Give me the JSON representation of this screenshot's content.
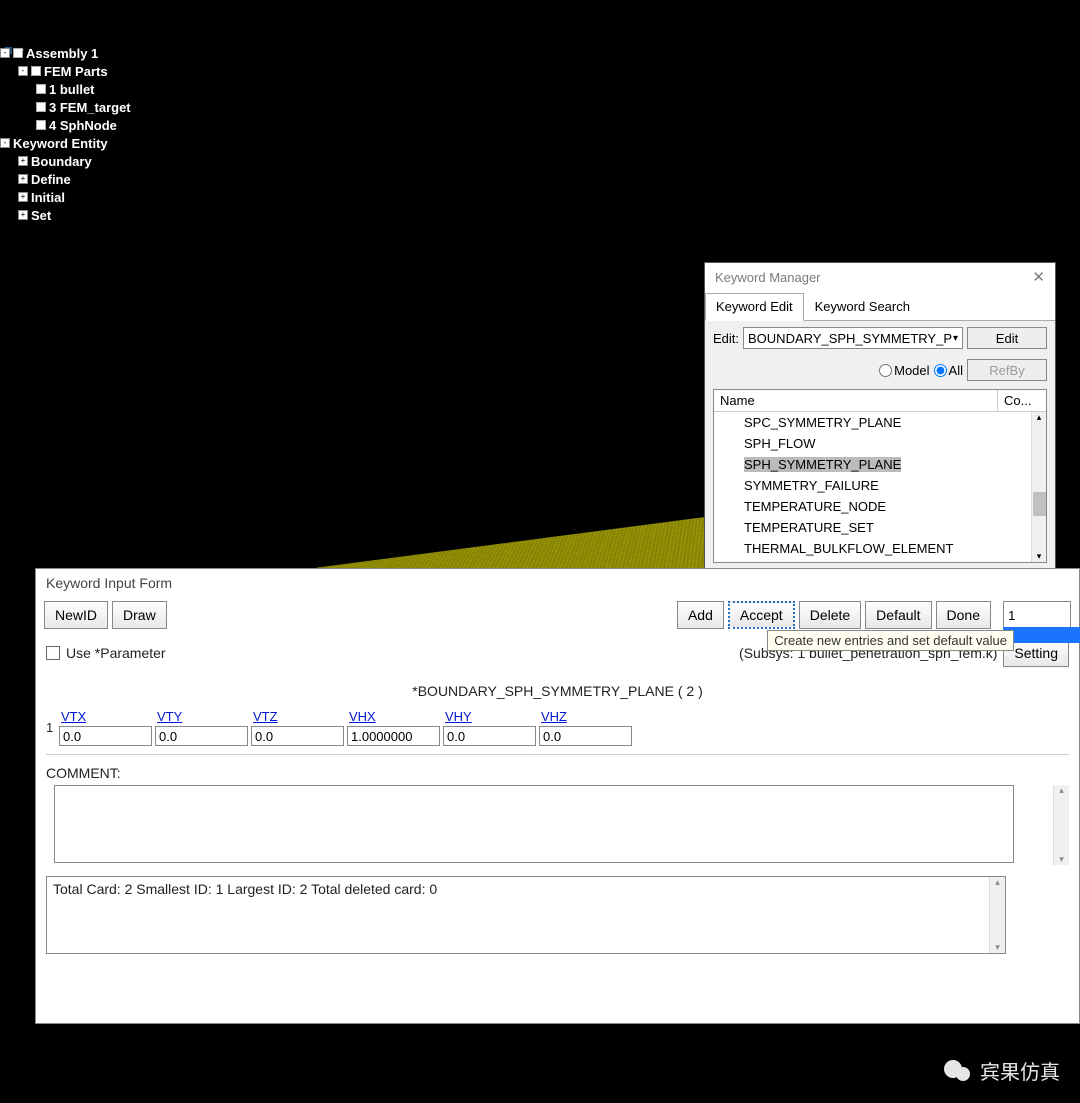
{
  "tree": {
    "root": "Assembly 1",
    "fem_parts": "FEM Parts",
    "bullet": "1 bullet",
    "fem_target": "3 FEM_target",
    "sph_node": "4 SphNode",
    "keyword_entity": "Keyword Entity",
    "boundary": "Boundary",
    "define": "Define",
    "initial": "Initial",
    "set": "Set"
  },
  "km": {
    "title": "Keyword Manager",
    "tab_edit": "Keyword Edit",
    "tab_search": "Keyword Search",
    "edit_label": "Edit:",
    "edit_value": "BOUNDARY_SPH_SYMMETRY_P",
    "edit_btn": "Edit",
    "radio_model": "Model",
    "radio_all": "All",
    "refby": "RefBy",
    "col_name": "Name",
    "col_co": "Co...",
    "items": [
      "SPC_SYMMETRY_PLANE",
      "SPH_FLOW",
      "SPH_SYMMETRY_PLANE",
      "SYMMETRY_FAILURE",
      "TEMPERATURE_NODE",
      "TEMPERATURE_SET",
      "THERMAL_BULKFLOW_ELEMENT"
    ]
  },
  "kif": {
    "title": "Keyword Input Form",
    "newid": "NewID",
    "draw": "Draw",
    "add": "Add",
    "accept": "Accept",
    "delete": "Delete",
    "default": "Default",
    "done": "Done",
    "idval": "1",
    "tooltip": "Create new entries and set default value",
    "use_param": "Use *Parameter",
    "subsys": "(Subsys: 1 bullet_penetration_sph_fem.k)",
    "setting": "Setting",
    "header": "*BOUNDARY_SPH_SYMMETRY_PLANE    ( 2 )",
    "rownum": "1",
    "cols": [
      {
        "label": "VTX",
        "val": "0.0"
      },
      {
        "label": "VTY",
        "val": "0.0"
      },
      {
        "label": "VTZ",
        "val": "0.0"
      },
      {
        "label": "VHX",
        "val": "1.0000000"
      },
      {
        "label": "VHY",
        "val": "0.0"
      },
      {
        "label": "VHZ",
        "val": "0.0"
      }
    ],
    "comment": "COMMENT:",
    "stats": "Total Card: 2    Smallest ID: 1    Largest ID: 2   Total deleted card:  0"
  },
  "watermark": "宾果仿真"
}
